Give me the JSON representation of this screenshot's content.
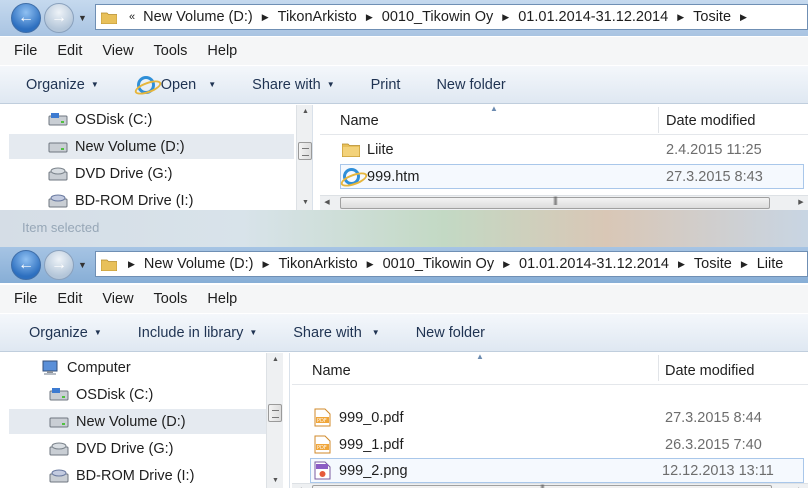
{
  "top": {
    "breadcrumbs": [
      "«",
      "New Volume (D:)",
      "TikonArkisto",
      "0010_Tikowin Oy",
      "01.01.2014-31.12.2014",
      "Tosite"
    ],
    "menu": [
      "File",
      "Edit",
      "View",
      "Tools",
      "Help"
    ],
    "toolbar": {
      "organize": "Organize",
      "open": "Open",
      "share": "Share with",
      "print": "Print",
      "new_folder": "New folder"
    },
    "tree": [
      {
        "label": "OSDisk (C:)",
        "icon": "hard-drive-icon"
      },
      {
        "label": "New Volume (D:)",
        "icon": "hard-drive-icon",
        "selected": true
      },
      {
        "label": "DVD Drive (G:)",
        "icon": "dvd-drive-icon"
      },
      {
        "label": "BD-ROM Drive (I:)",
        "icon": "bd-drive-icon"
      }
    ],
    "columns": {
      "name": "Name",
      "date": "Date modified"
    },
    "files": [
      {
        "name": "Liite",
        "date": "2.4.2015 11:25",
        "icon": "folder-icon"
      },
      {
        "name": "999.htm",
        "date": "27.3.2015 8:43",
        "icon": "html-file-icon"
      }
    ]
  },
  "bottom": {
    "title_text": "Item selected",
    "breadcrumbs": [
      "New Volume (D:)",
      "TikonArkisto",
      "0010_Tikowin Oy",
      "01.01.2014-31.12.2014",
      "Tosite",
      "Liite"
    ],
    "menu": [
      "File",
      "Edit",
      "View",
      "Tools",
      "Help"
    ],
    "toolbar": {
      "organize": "Organize",
      "include": "Include in library",
      "share": "Share with",
      "new_folder": "New folder"
    },
    "tree": [
      {
        "label": "Computer",
        "icon": "computer-icon"
      },
      {
        "label": "OSDisk (C:)",
        "icon": "hard-drive-icon"
      },
      {
        "label": "New Volume (D:)",
        "icon": "hard-drive-icon",
        "selected": true
      },
      {
        "label": "DVD Drive (G:)",
        "icon": "dvd-drive-icon"
      },
      {
        "label": "BD-ROM Drive (I:)",
        "icon": "bd-drive-icon"
      }
    ],
    "columns": {
      "name": "Name",
      "date": "Date modified"
    },
    "files": [
      {
        "name": "999_0.pdf",
        "date": "27.3.2015 8:44",
        "icon": "pdf-file-icon"
      },
      {
        "name": "999_1.pdf",
        "date": "26.3.2015 7:40",
        "icon": "pdf-file-icon"
      },
      {
        "name": "999_2.png",
        "date": "12.12.2013 13:11",
        "icon": "png-file-icon"
      }
    ]
  }
}
